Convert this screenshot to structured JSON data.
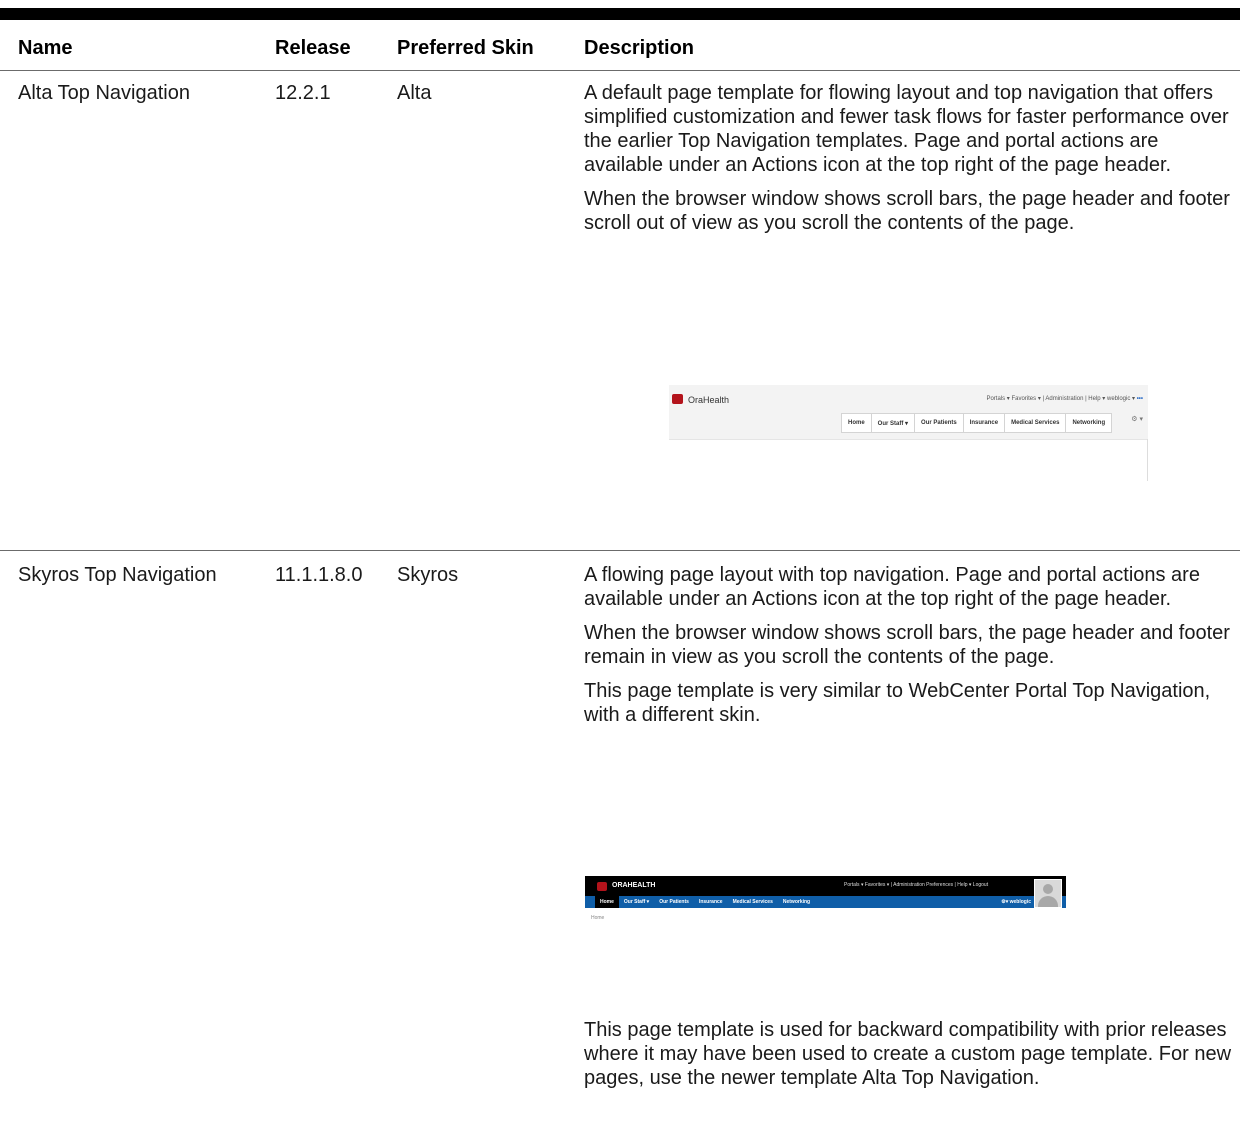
{
  "headers": {
    "name": "Name",
    "release": "Release",
    "skin": "Preferred Skin",
    "description": "Description"
  },
  "rows": [
    {
      "name": "Alta Top Navigation",
      "release": "12.2.1",
      "skin": "Alta",
      "paragraphs": [
        "A default page template for flowing layout and top navigation that offers simplified customization and fewer task flows for faster performance over the earlier Top Navigation templates. Page and portal actions are available under an Actions icon at the top right of the page header.",
        "When the browser window shows scroll bars, the page header and footer scroll out of view as you scroll the contents of the page."
      ],
      "screenshot": {
        "brand": "OraHealth",
        "utility": "Portals ▾  Favorites ▾  |  Administration  |  Help ▾  weblogic ▾",
        "ellipsis": "•••",
        "nav": [
          "Home",
          "Our Staff ▾",
          "Our Patients",
          "Insurance",
          "Medical Services",
          "Networking"
        ],
        "gear": "⚙ ▾"
      }
    },
    {
      "name": "Skyros Top Navigation",
      "release": "11.1.1.8.0",
      "skin": "Skyros",
      "paragraphs": [
        "A flowing page layout with top navigation. Page and portal actions are available under an Actions icon at the top right of the page header.",
        "When the browser window shows scroll bars, the page header and footer remain in view as you scroll the contents of the page.",
        "This page template is very similar to WebCenter Portal Top Navigation, with a different skin."
      ],
      "screenshot": {
        "brand": "ORAHEALTH",
        "utility": "Portals ▾   Favorites ▾   |   Administration   Preferences   |   Help ▾   Logout",
        "nav": [
          "Home",
          "Our Staff ▾",
          "Our Patients",
          "Insurance",
          "Medical Services",
          "Networking"
        ],
        "user": "⚙▾  weblogic",
        "breadcrumb": "Home"
      },
      "after_paragraph": "This page template is used for backward compatibility with prior releases where it may have been used to create a custom page template. For new pages, use the newer template Alta Top Navigation."
    }
  ]
}
